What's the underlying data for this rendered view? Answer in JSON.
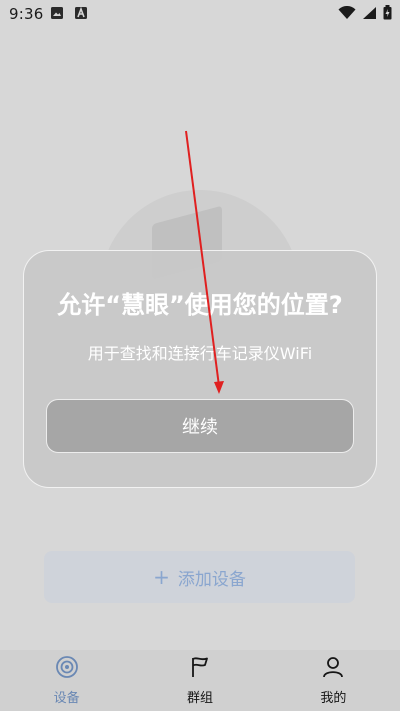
{
  "status_bar": {
    "time": "9:36",
    "icons": [
      "image-icon",
      "a-letter-icon",
      "wifi-icon",
      "signal-icon",
      "battery-icon"
    ]
  },
  "main": {
    "add_device_label": "添加设备"
  },
  "dialog": {
    "title": "允许“慧眼”使用您的位置?",
    "subtitle": "用于查找和连接行车记录仪WiFi",
    "continue_label": "继续"
  },
  "tabbar": {
    "items": [
      {
        "label": "设备",
        "icon": "device-icon",
        "active": true
      },
      {
        "label": "群组",
        "icon": "flag-icon",
        "active": false
      },
      {
        "label": "我的",
        "icon": "profile-icon",
        "active": false
      }
    ]
  },
  "colors": {
    "accent": "#6a88b4",
    "annotation": "#e02020"
  }
}
